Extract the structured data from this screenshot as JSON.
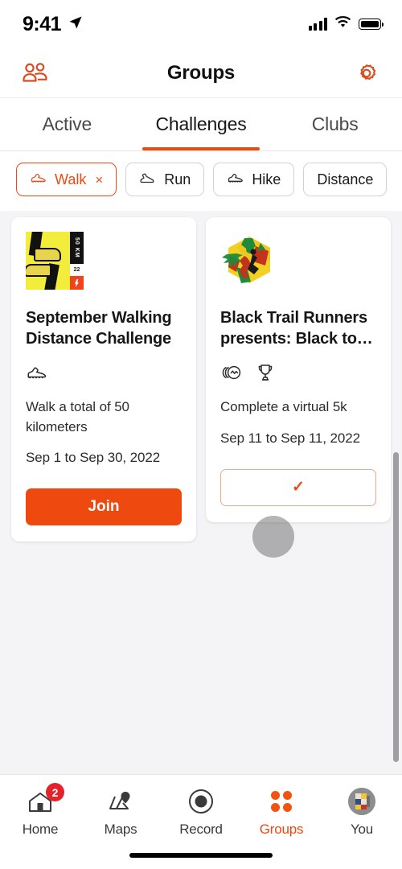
{
  "statusbar": {
    "time": "9:41",
    "location_icon": "location-arrow-icon",
    "signal_icon": "cellular-signal-icon",
    "wifi_icon": "wifi-icon",
    "battery_icon": "battery-full-icon"
  },
  "header": {
    "title": "Groups",
    "left_icon": "people-group-icon",
    "right_icon": "gear-icon"
  },
  "tabs": [
    {
      "label": "Active",
      "active": false
    },
    {
      "label": "Challenges",
      "active": true
    },
    {
      "label": "Clubs",
      "active": false
    }
  ],
  "filters": [
    {
      "label": "Walk",
      "selected": true,
      "icon": "walking-shoe-icon",
      "remove": "×"
    },
    {
      "label": "Run",
      "selected": false,
      "icon": "running-shoe-icon"
    },
    {
      "label": "Hike",
      "selected": false,
      "icon": "hiking-boot-icon"
    },
    {
      "label": "Distance",
      "selected": false,
      "icon": ""
    }
  ],
  "cards": [
    {
      "thumb": "walking-challenge-poster",
      "poster_distance": "50 KM",
      "poster_year": "22",
      "title": "September Walking Distance Challenge",
      "icons": [
        "walking-shoe-icon"
      ],
      "description": "Walk a total of 50 kilometers",
      "dates": "Sep 1 to Sep 30, 2022",
      "button_label": "Join",
      "button_state": "join"
    },
    {
      "thumb": "black-trail-runners-5k-logo",
      "title": "Black Trail Runners presents: Black to…",
      "icons": [
        "activity-badge-icon",
        "trophy-icon"
      ],
      "description": "Complete a virtual 5k",
      "dates": "Sep 11 to Sep 11, 2022",
      "button_label": "✓",
      "button_state": "joined"
    }
  ],
  "bottom_nav": [
    {
      "label": "Home",
      "icon": "home-icon",
      "badge": "2",
      "active": false
    },
    {
      "label": "Maps",
      "icon": "map-pin-icon",
      "badge": "",
      "active": false
    },
    {
      "label": "Record",
      "icon": "record-circle-icon",
      "badge": "",
      "active": false
    },
    {
      "label": "Groups",
      "icon": "four-dots-icon",
      "badge": "",
      "active": true
    },
    {
      "label": "You",
      "icon": "user-avatar-icon",
      "badge": "",
      "active": false
    }
  ],
  "colors": {
    "accent": "#EE4A10",
    "badge_red": "#E3222B",
    "background": "#F4F4F7",
    "card": "#FFFFFF"
  }
}
